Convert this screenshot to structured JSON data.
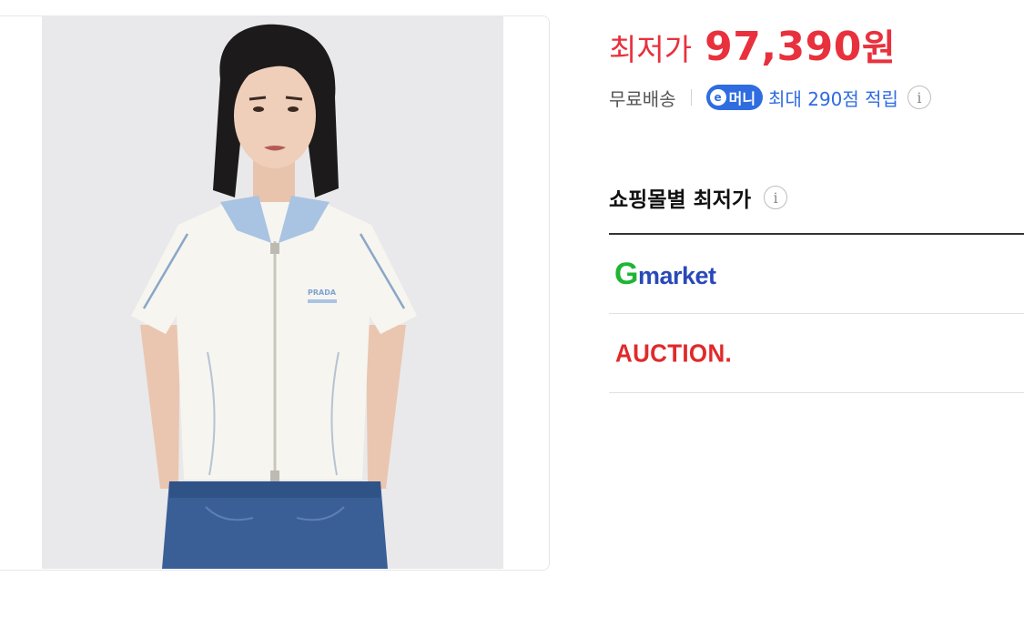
{
  "price": {
    "label": "최저가",
    "value": "97,390",
    "unit": "원"
  },
  "benefits": {
    "shipping": "무료배송",
    "emoney_badge_icon": "e",
    "emoney_badge_label": "머니",
    "reward_text": "최대 290점 적립",
    "info_icon": "i"
  },
  "store_section": {
    "title": "쇼핑몰별 최저가",
    "info_icon": "i",
    "stores": [
      {
        "logo_g": "G",
        "logo_rest": "market"
      },
      {
        "logo": "AUCTION."
      }
    ]
  },
  "product_image": {
    "logo_text": "PRADA"
  },
  "colors": {
    "price_red": "#e8313d",
    "emoney_blue": "#2f6ce0",
    "gmarket_green": "#1fb534",
    "gmarket_blue": "#2a49b8",
    "auction_red": "#e02a2a"
  }
}
